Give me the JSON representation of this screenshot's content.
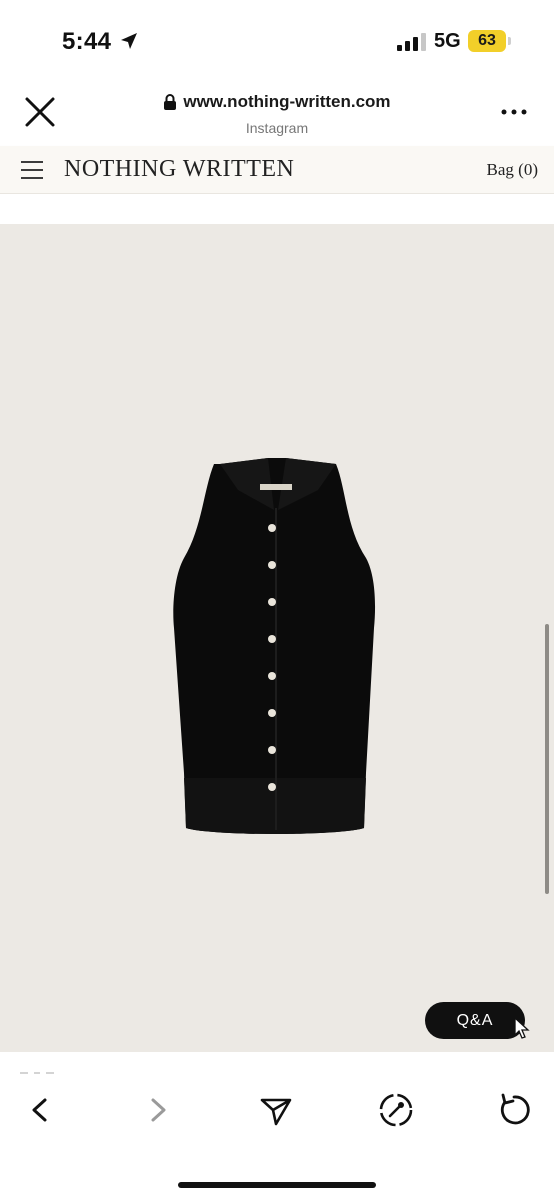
{
  "status_bar": {
    "time": "5:44",
    "network": "5G",
    "battery": "63",
    "battery_color": "#f2cf29"
  },
  "browser": {
    "url": "www.nothing-written.com",
    "source": "Instagram"
  },
  "site": {
    "brand": "NOTHING WRITTEN",
    "bag_label": "Bag (0)"
  },
  "product": {
    "image_icon": "black-sleeveless-collared-knit-vest",
    "background_color": "#ece9e4"
  },
  "qa_button": {
    "label": "Q&A"
  },
  "toolbar": {
    "back_icon": "chevron-left-icon",
    "forward_icon": "chevron-right-icon",
    "share_icon": "send-icon",
    "safari_icon": "compass-icon",
    "reload_icon": "reload-icon"
  }
}
